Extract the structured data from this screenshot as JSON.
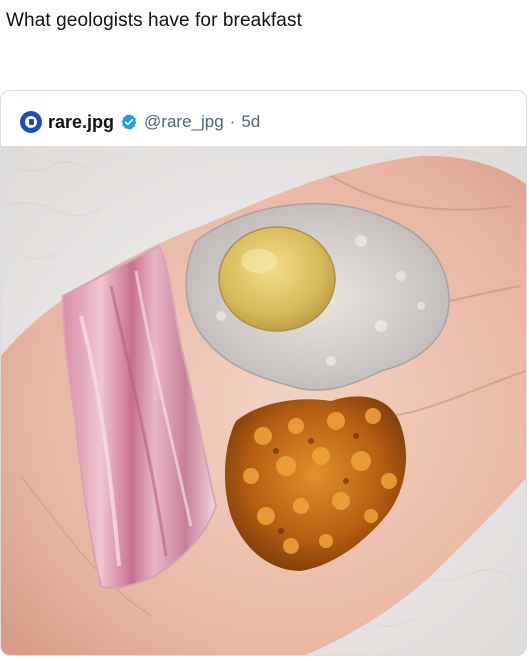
{
  "post": {
    "caption": "What geologists have for breakfast"
  },
  "embedded_tweet": {
    "display_name": "rare.jpg",
    "handle": "@rare_jpg",
    "separator": "·",
    "age": "5d",
    "avatar_icon": "camera-lens-icon",
    "verified_icon": "verified-badge-icon",
    "verified_color": "#1d9bf0"
  },
  "photo": {
    "subject": "hand-holding-three-minerals",
    "items": [
      "rhodochrosite-slice",
      "quartz-geode-with-fluorite",
      "orange-garnet-cluster"
    ]
  }
}
